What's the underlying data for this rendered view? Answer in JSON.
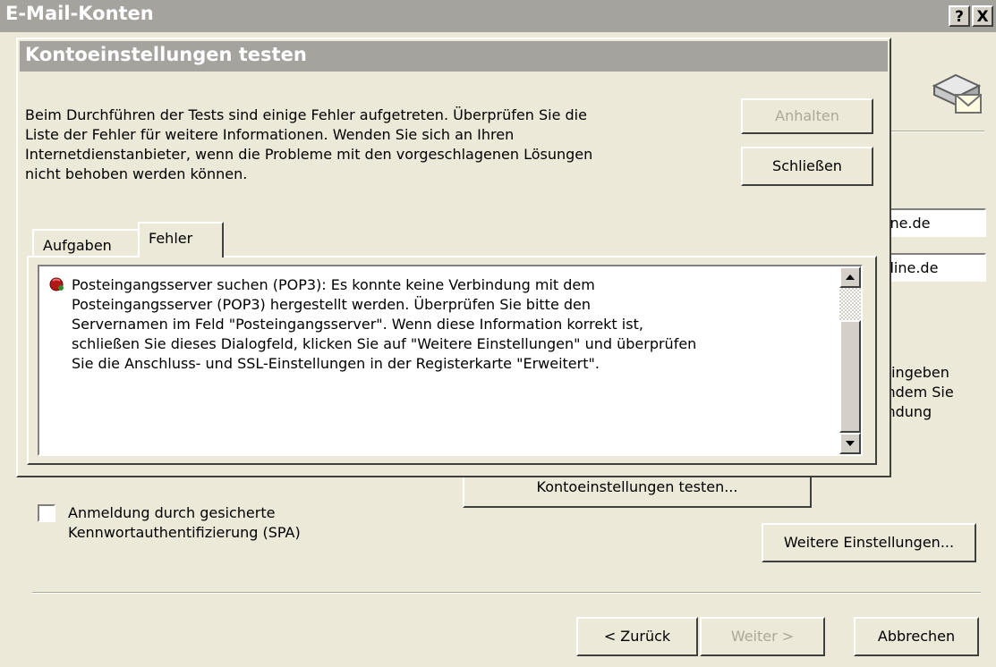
{
  "outer_window": {
    "title": "E-Mail-Konten",
    "help_button": "?",
    "close_button": "X",
    "field_email": "ine.de",
    "field_server": "lline.de",
    "info_text": "Eingeben\nindem Sie\nindung",
    "test_button_label": "Kontoeinstellungen testen...",
    "spa_checkbox_label": "Anmeldung durch gesicherte\nKennwortauthentifizierung (SPA)",
    "more_settings_button": "Weitere Einstellungen...",
    "back_button": "< Zurück",
    "next_button": "Weiter >",
    "cancel_button": "Abbrechen"
  },
  "dialog": {
    "title": "Kontoeinstellungen testen",
    "message": "Beim Durchführen der Tests sind einige Fehler aufgetreten. Überprüfen Sie die\nListe der Fehler für weitere Informationen. Wenden Sie sich an Ihren\nInternetdienstanbieter, wenn die Probleme mit den vorgeschlagenen Lösungen\nnicht behoben werden können.",
    "stop_button": "Anhalten",
    "close_button": "Schließen",
    "tabs": [
      {
        "label": "Aufgaben"
      },
      {
        "label": "Fehler"
      }
    ],
    "errors": [
      {
        "icon": "error-icon",
        "text": "Posteingangsserver suchen (POP3): Es konnte keine Verbindung mit dem\nPosteingangsserver (POP3) hergestellt werden. Überprüfen Sie bitte den\nServernamen im Feld \"Posteingangsserver\". Wenn diese Information korrekt ist,\nschließen Sie dieses Dialogfeld, klicken Sie auf \"Weitere Einstellungen\" und überprüfen\nSie die Anschluss- und SSL-Einstellungen in der Registerkarte \"Erweitert\"."
      }
    ]
  }
}
